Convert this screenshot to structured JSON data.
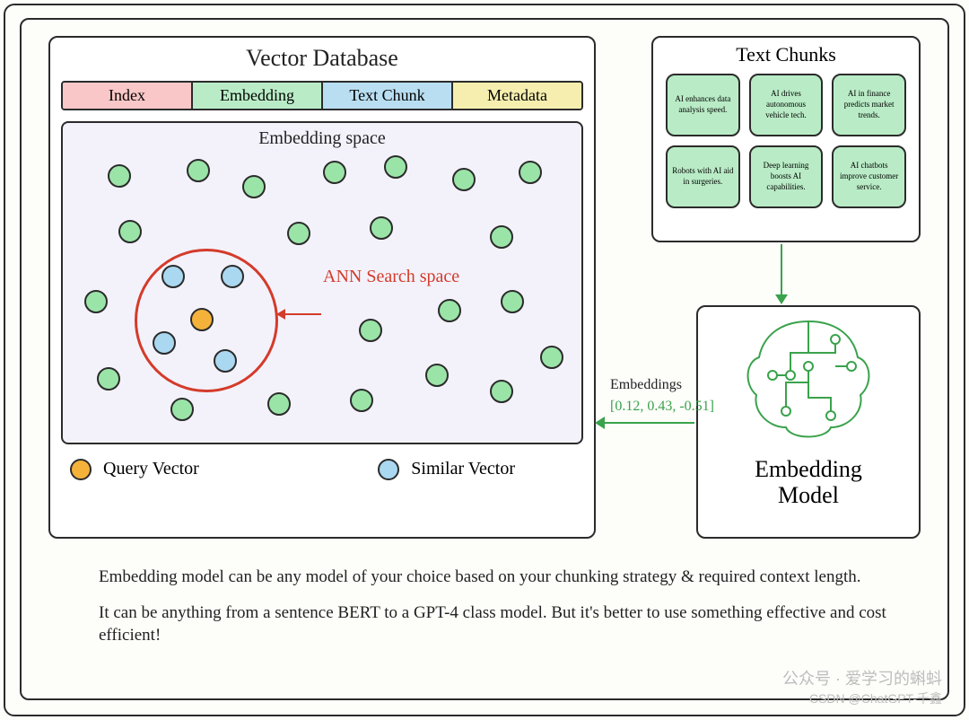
{
  "vector_db": {
    "title": "Vector Database",
    "columns": {
      "index": "Index",
      "embedding": "Embedding",
      "text_chunk": "Text Chunk",
      "metadata": "Metadata"
    },
    "embedding_space": {
      "title": "Embedding space",
      "ann_label": "ANN Search space",
      "legend": {
        "query": "Query Vector",
        "similar": "Similar Vector"
      }
    }
  },
  "text_chunks": {
    "title": "Text Chunks",
    "items": [
      "AI enhances data analysis speed.",
      "AI drives autonomous vehicle tech.",
      "AI in finance predicts market trends.",
      "Robots with AI aid in surgeries.",
      "Deep learning boosts AI capabilities.",
      "AI chatbots improve customer service."
    ]
  },
  "embeddings": {
    "label": "Embeddings",
    "example": "[0.12, 0.43, -0.51]"
  },
  "embedding_model": {
    "title_line1": "Embedding",
    "title_line2": "Model"
  },
  "body": {
    "p1": "Embedding model can be any model of your choice based on your chunking strategy & required context length.",
    "p2": "It can be anything from a sentence BERT to a GPT-4 class model. But it's better to use something effective and cost efficient!"
  },
  "watermark": {
    "wx": "公众号 · 爱学习的蝌蚪",
    "csdn": "CSDN @ChatGPT-千鑫"
  }
}
